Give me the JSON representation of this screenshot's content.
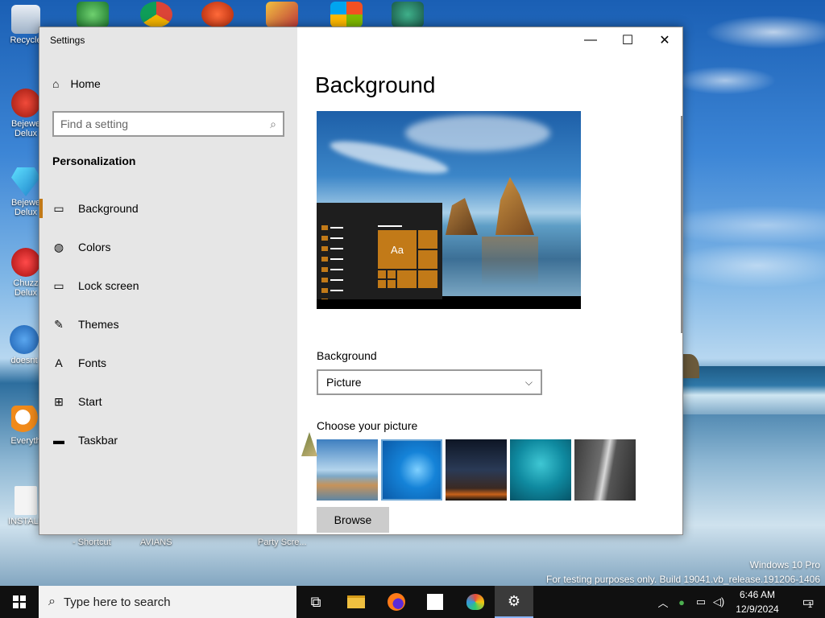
{
  "desktop": {
    "icons": [
      {
        "label": "Recycle",
        "glyph": "recycle-bin-icon"
      },
      {
        "label": "Bejewe Delux",
        "glyph": "bejeweled-icon"
      },
      {
        "label": "Bejewe Delux",
        "glyph": "diamond-icon"
      },
      {
        "label": "Chuzz Delux",
        "glyph": "chuzzle-icon"
      },
      {
        "label": "doesnt",
        "glyph": "bird-icon"
      },
      {
        "label": "Everyth",
        "glyph": "search-magnifier-icon"
      },
      {
        "label": "INSTALL",
        "glyph": "document-icon"
      }
    ],
    "bottom_labels": [
      "- Shortcut",
      "AVIANS",
      "Party Scre..."
    ],
    "watermark_line1": "Windows 10 Pro",
    "watermark_line2": "For testing purposes only. Build 19041.vb_release.191206-1406"
  },
  "window": {
    "title": "Settings",
    "minimize_glyph": "—",
    "maximize_glyph": "☐",
    "close_glyph": "✕"
  },
  "sidebar": {
    "home_label": "Home",
    "search_placeholder": "Find a setting",
    "section_title": "Personalization",
    "items": [
      {
        "label": "Background",
        "icon": "picture-icon",
        "glyph": "▭"
      },
      {
        "label": "Colors",
        "icon": "palette-icon",
        "glyph": "◍"
      },
      {
        "label": "Lock screen",
        "icon": "lock-screen-icon",
        "glyph": "▭"
      },
      {
        "label": "Themes",
        "icon": "brush-icon",
        "glyph": "✎"
      },
      {
        "label": "Fonts",
        "icon": "fonts-icon",
        "glyph": "A"
      },
      {
        "label": "Start",
        "icon": "start-tiles-icon",
        "glyph": "⊞"
      },
      {
        "label": "Taskbar",
        "icon": "taskbar-icon",
        "glyph": "▬"
      }
    ]
  },
  "content": {
    "page_title": "Background",
    "preview_tile_text": "Aa",
    "background_label": "Background",
    "background_value": "Picture",
    "choose_label": "Choose your picture",
    "browse_label": "Browse"
  },
  "taskbar": {
    "search_placeholder": "Type here to search",
    "apps": [
      "task-view-icon",
      "file-explorer-icon",
      "firefox-icon",
      "user-app-icon",
      "paint-icon",
      "settings-gear-icon"
    ],
    "time": "6:46 AM",
    "date": "12/9/2024",
    "notification_count": "1"
  },
  "colors": {
    "accent": "#c27a18",
    "taskbar": "#101010",
    "sidebar": "#e6e6e6"
  }
}
